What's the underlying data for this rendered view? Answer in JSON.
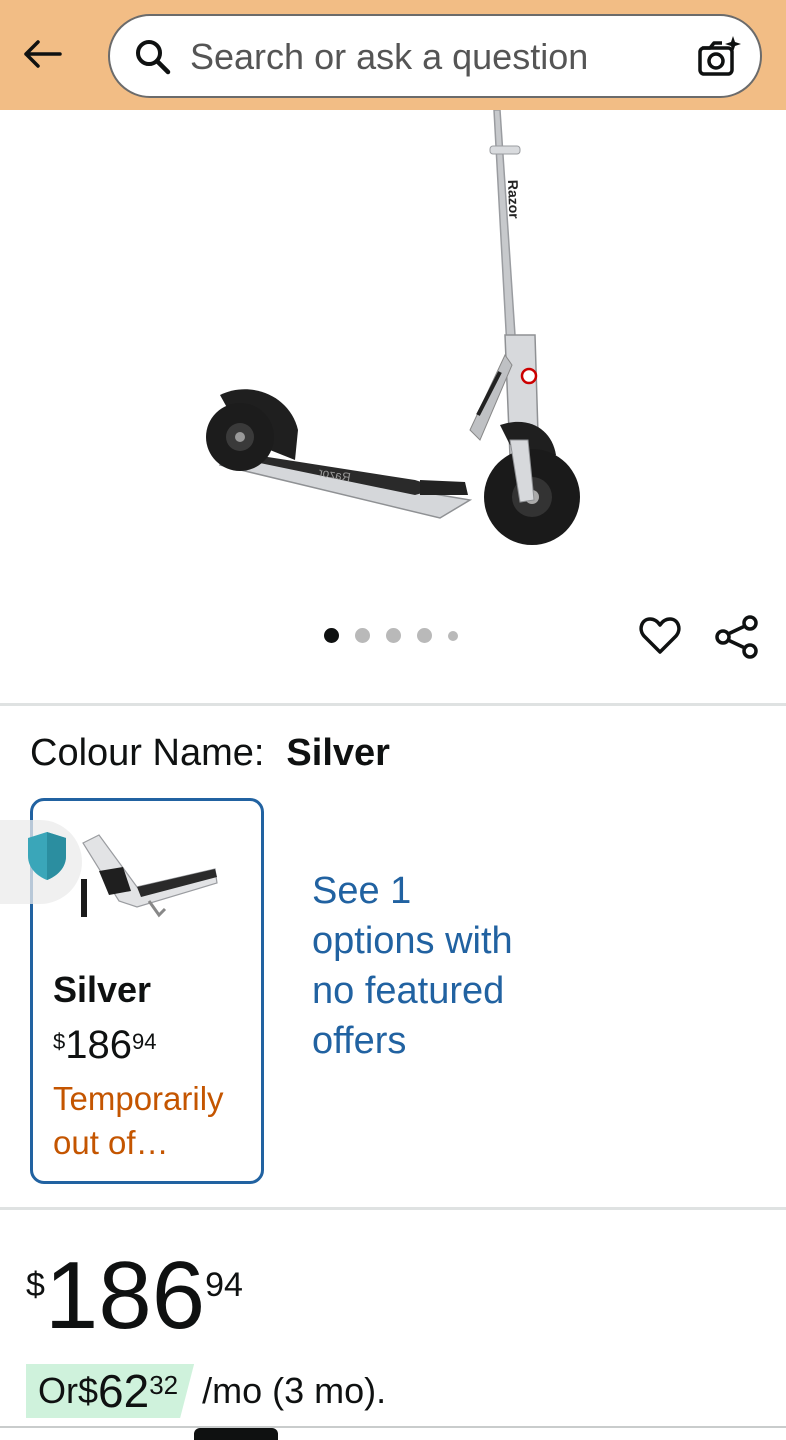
{
  "header": {
    "search_placeholder": "Search or ask a question",
    "back_icon": "arrow-left-icon",
    "camera_icon": "camera-sparkle-icon",
    "search_icon": "search-icon",
    "bg_color": "#f2bd85"
  },
  "gallery": {
    "image_count": 5,
    "active_index": 0,
    "wishlist_icon": "heart-icon",
    "share_icon": "share-icon"
  },
  "variant": {
    "label": "Colour Name:",
    "selected_value": "Silver",
    "swatch": {
      "name": "Silver",
      "price_currency": "$",
      "price_whole": "186",
      "price_cents": "94",
      "stock": "Temporarily out of…"
    },
    "see_options": "See 1 options with no featured offers"
  },
  "price": {
    "currency": "$",
    "whole": "186",
    "cents": "94"
  },
  "installment": {
    "prefix": "Or ",
    "currency": "$",
    "whole": "62",
    "cents": "32",
    "suffix": "/mo (3 mo)."
  },
  "colors": {
    "link": "#2162a1",
    "stock_warning": "#c45500",
    "selected_border": "#2162a1",
    "installment_badge": "#cff2dc"
  }
}
